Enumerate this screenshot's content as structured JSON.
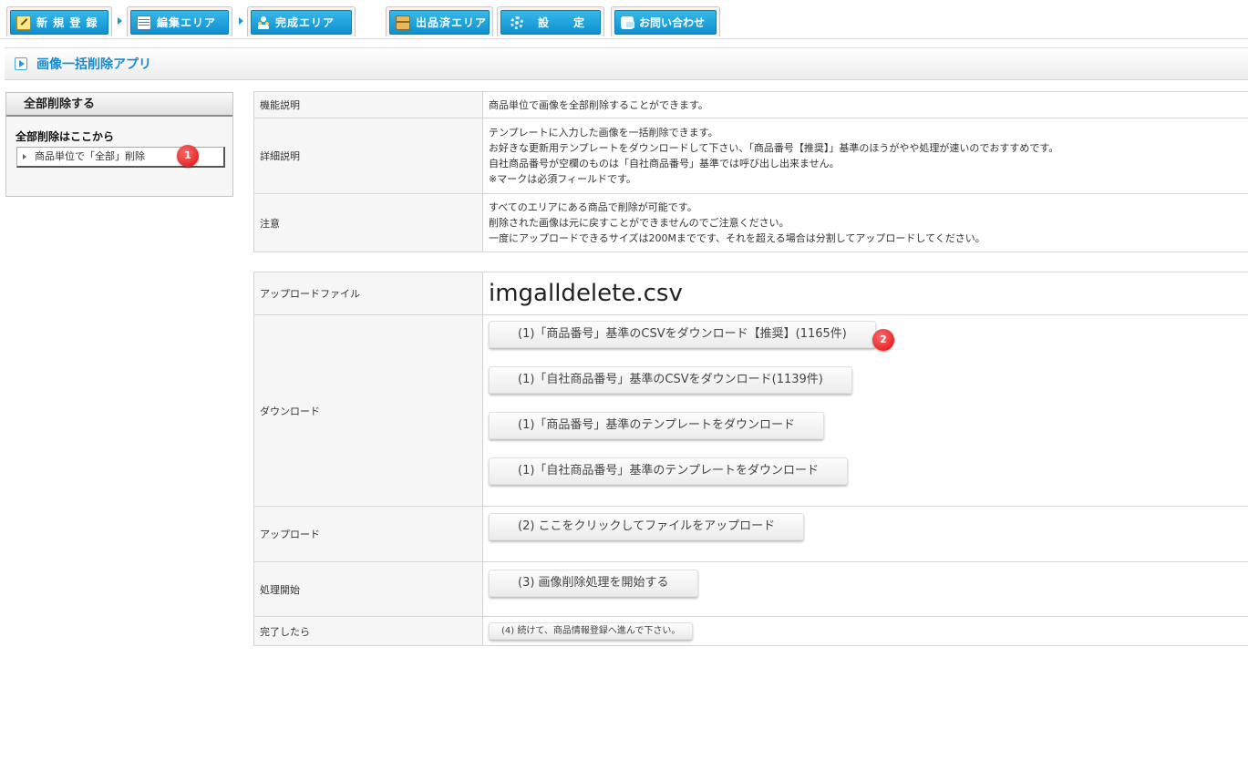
{
  "nav": {
    "tabs": [
      {
        "label": "新 規 登 録",
        "icon": "pencil-icon"
      },
      {
        "label": "編集エリア",
        "icon": "table-icon"
      },
      {
        "label": "完成エリア",
        "icon": "people-icon"
      },
      {
        "label": "出品済エリア",
        "icon": "box-icon"
      },
      {
        "label": "設　　定",
        "icon": "gear-icon"
      },
      {
        "label": "お問い合わせ",
        "icon": "chat-icon"
      }
    ]
  },
  "page": {
    "title": "画像一括削除アプリ"
  },
  "sidebar": {
    "header": "全部削除する",
    "subheading": "全部削除はここから",
    "item_label": "商品単位で「全部」削除",
    "badge": "1"
  },
  "info": {
    "feature_label": "機能説明",
    "feature_text": "商品単位で画像を全部削除することができます。",
    "detail_label": "詳細説明",
    "detail_lines": [
      "テンプレートに入力した画像を一括削除できます。",
      "お好きな更新用テンプレートをダウンロードして下さい、「商品番号【推奨】」基準のほうがやや処理が速いのでおすすめです。",
      "自社商品番号が空欄のものは「自社商品番号」基準では呼び出し出来ません。",
      "※マークは必須フィールドです。"
    ],
    "caution_label": "注意",
    "caution_lines": [
      "すべてのエリアにある商品で削除が可能です。",
      "削除された画像は元に戻すことができませんのでご注意ください。",
      "一度にアップロードできるサイズは200Mまでです、それを超える場合は分割してアップロードしてください。"
    ]
  },
  "form": {
    "upload_file_label": "アップロードファイル",
    "upload_file_name": "imgalldelete.csv",
    "download_label": "ダウンロード",
    "download_buttons": [
      "(1)「商品番号」基準のCSVをダウンロード【推奨】(1165件)",
      "(1)「自社商品番号」基準のCSVをダウンロード(1139件)",
      "(1)「商品番号」基準のテンプレートをダウンロード",
      "(1)「自社商品番号」基準のテンプレートをダウンロード"
    ],
    "download_badge": "2",
    "upload_label": "アップロード",
    "upload_button": "(2) ここをクリックしてファイルをアップロード",
    "process_label": "処理開始",
    "process_button": "(3) 画像削除処理を開始する",
    "done_label": "完了したら",
    "done_button": "(4) 続けて、商品情報登録へ進んで下さい。"
  }
}
